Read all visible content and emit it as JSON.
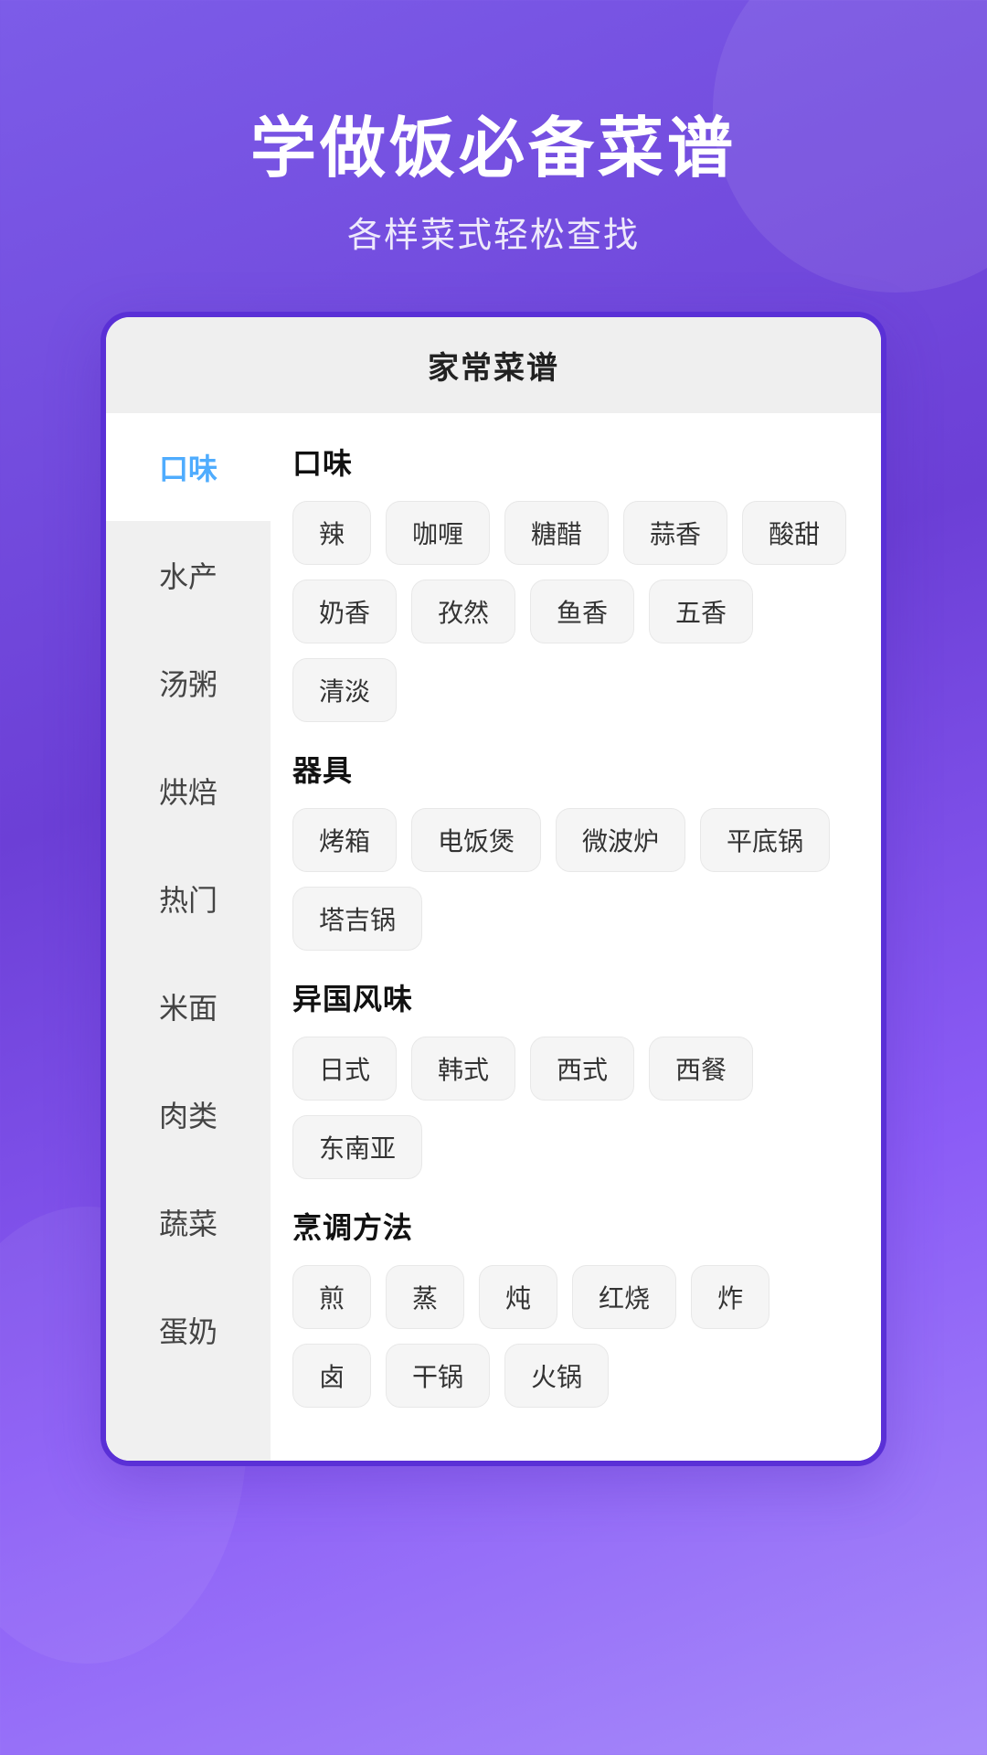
{
  "header": {
    "title": "学做饭必备菜谱",
    "subtitle": "各样菜式轻松查找"
  },
  "card": {
    "title": "家常菜谱"
  },
  "sidebar": {
    "items": [
      {
        "label": "口味",
        "active": true
      },
      {
        "label": "水产",
        "active": false
      },
      {
        "label": "汤粥",
        "active": false
      },
      {
        "label": "烘焙",
        "active": false
      },
      {
        "label": "热门",
        "active": false
      },
      {
        "label": "米面",
        "active": false
      },
      {
        "label": "肉类",
        "active": false
      },
      {
        "label": "蔬菜",
        "active": false
      },
      {
        "label": "蛋奶",
        "active": false
      }
    ]
  },
  "sections": [
    {
      "title": "口味",
      "tags": [
        "辣",
        "咖喱",
        "糖醋",
        "蒜香",
        "酸甜",
        "奶香",
        "孜然",
        "鱼香",
        "五香",
        "清淡"
      ]
    },
    {
      "title": "器具",
      "tags": [
        "烤箱",
        "电饭煲",
        "微波炉",
        "平底锅",
        "塔吉锅"
      ]
    },
    {
      "title": "异国风味",
      "tags": [
        "日式",
        "韩式",
        "西式",
        "西餐",
        "东南亚"
      ]
    },
    {
      "title": "烹调方法",
      "tags": [
        "煎",
        "蒸",
        "炖",
        "红烧",
        "炸",
        "卤",
        "干锅",
        "火锅"
      ]
    }
  ]
}
